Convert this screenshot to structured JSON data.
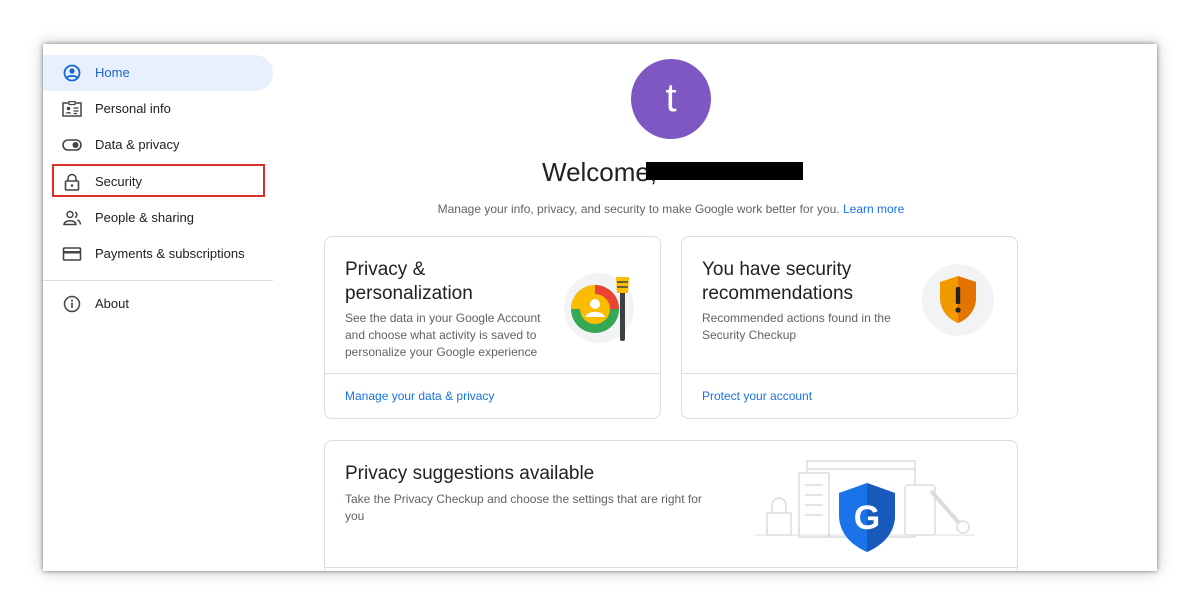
{
  "sidebar": {
    "items": [
      {
        "label": "Home",
        "icon": "account-circle-icon",
        "active": true
      },
      {
        "label": "Personal info",
        "icon": "id-card-icon"
      },
      {
        "label": "Data & privacy",
        "icon": "toggle-icon"
      },
      {
        "label": "Security",
        "icon": "lock-icon"
      },
      {
        "label": "People & sharing",
        "icon": "people-icon"
      },
      {
        "label": "Payments & subscriptions",
        "icon": "credit-card-icon"
      }
    ],
    "about": {
      "label": "About",
      "icon": "info-icon"
    }
  },
  "profile": {
    "initial": "t",
    "avatar_color": "#7e57c2"
  },
  "welcome": {
    "prefix": "Welcome,"
  },
  "subtitle": {
    "text": "Manage your info, privacy, and security to make Google work better for you.",
    "link": "Learn more"
  },
  "cards": {
    "privacy": {
      "title": "Privacy & personalization",
      "description": "See the data in your Google Account and choose what activity is saved to personalize your Google experience",
      "link": "Manage your data & privacy"
    },
    "security": {
      "title": "You have security recommendations",
      "description": "Recommended actions found in the Security Checkup",
      "link": "Protect your account"
    },
    "suggestions": {
      "title": "Privacy suggestions available",
      "description": "Take the Privacy Checkup and choose the settings that are right for you",
      "badge_letter": "G"
    }
  },
  "colors": {
    "accent": "#1a73e8",
    "active_bg": "#e8f0fe",
    "highlight": "#d93025",
    "warning": "#f29900"
  }
}
